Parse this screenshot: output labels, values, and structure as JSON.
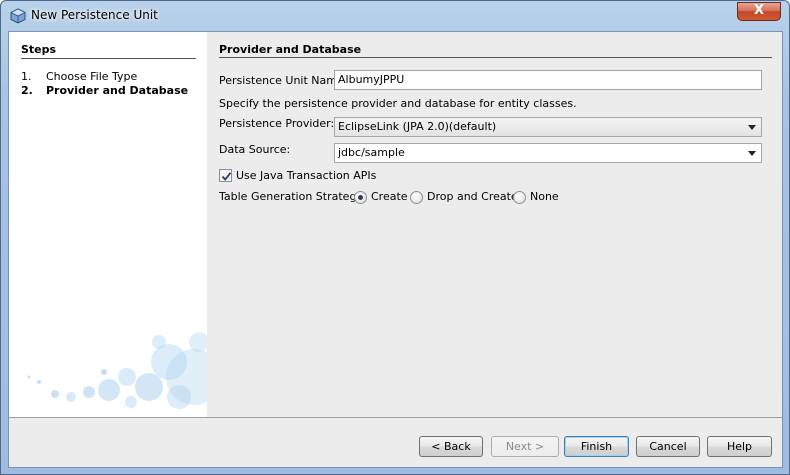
{
  "window": {
    "title": "New Persistence Unit",
    "close_glyph": "X"
  },
  "steps": {
    "title": "Steps",
    "items": [
      {
        "num": "1.",
        "label": "Choose File Type"
      },
      {
        "num": "2.",
        "label": "Provider and Database"
      }
    ]
  },
  "main": {
    "section_title": "Provider and Database",
    "unit_name_label": "Persistence Unit Name:",
    "unit_name_value": "AlbumyJPPU",
    "description": "Specify the persistence provider and database for entity classes.",
    "provider_label": "Persistence Provider:",
    "provider_value": "EclipseLink (JPA 2.0)(default)",
    "datasource_label": "Data Source:",
    "datasource_value": "jdbc/sample",
    "jta_label": "Use Java Transaction APIs",
    "jta_checked": true,
    "strategy_label": "Table Generation Strategy:",
    "strategy_options": [
      "Create",
      "Drop and Create",
      "None"
    ],
    "strategy_selected": "Create"
  },
  "buttons": {
    "back": "< Back",
    "next": "Next >",
    "finish": "Finish",
    "cancel": "Cancel",
    "help": "Help"
  },
  "colors": {
    "title_bar": "#a9c4e2",
    "close_button": "#c4472a",
    "panel_bg": "#ececec",
    "bubble": "#9ec8ea"
  }
}
